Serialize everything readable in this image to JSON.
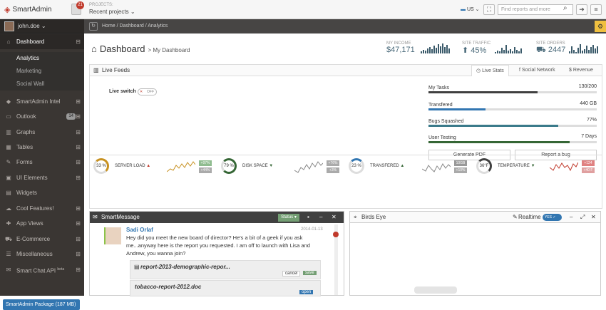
{
  "app": {
    "name": "SmartAdmin",
    "notif_count": "21",
    "projects_label": "PROJECTS:",
    "projects_value": "Recent projects",
    "lang": "US",
    "search_placeholder": "Find reports and more"
  },
  "user": {
    "name": "john.doe"
  },
  "sidebar": {
    "items": [
      {
        "label": "Dashboard",
        "icon": "home-icon",
        "active": true
      },
      {
        "label": "SmartAdmin Intel",
        "icon": "cube-icon"
      },
      {
        "label": "Outlook",
        "icon": "inbox-icon",
        "badge": "14"
      },
      {
        "label": "Graphs",
        "icon": "bar-chart-icon"
      },
      {
        "label": "Tables",
        "icon": "table-icon"
      },
      {
        "label": "Forms",
        "icon": "pencil-icon"
      },
      {
        "label": "UI Elements",
        "icon": "desktop-icon"
      },
      {
        "label": "Widgets",
        "icon": "widget-icon"
      },
      {
        "label": "Cool Features!",
        "icon": "cloud-icon"
      },
      {
        "label": "App Views",
        "icon": "puzzle-icon"
      },
      {
        "label": "E-Commerce",
        "icon": "cart-icon"
      },
      {
        "label": "Miscellaneous",
        "icon": "list-icon"
      },
      {
        "label": "Smart Chat API",
        "sup": "beta",
        "icon": "chat-icon"
      }
    ],
    "subitems": [
      "Analytics",
      "Marketing",
      "Social Wall"
    ],
    "package": "SmartAdmin Package (187 MB)"
  },
  "breadcrumb": [
    "Home",
    "Dashboard",
    "Analytics"
  ],
  "page": {
    "title": "Dashboard",
    "subtitle": "> My Dashboard"
  },
  "stats": [
    {
      "label": "MY INCOME",
      "value": "$47,171"
    },
    {
      "label": "SITE TRAFFIC",
      "value": "45%"
    },
    {
      "label": "SITE ORDERS",
      "value": "2447"
    }
  ],
  "live": {
    "title": "Live Feeds",
    "tabs": [
      "Live Stats",
      "Social Network",
      "Revenue"
    ],
    "switch_label": "Live switch",
    "switch_state": "OFF",
    "tasks": [
      {
        "label": "My Tasks",
        "value": "130/200",
        "pct": 0.65,
        "color": "#404040"
      },
      {
        "label": "Transfered",
        "value": "440 GB",
        "pct": 0.34,
        "color": "#3276b1"
      },
      {
        "label": "Bugs Squashed",
        "value": "77%",
        "pct": 0.77,
        "color": "#3a7a8a"
      },
      {
        "label": "User Testing",
        "value": "7 Days",
        "pct": 0.84,
        "color": "#356635"
      }
    ],
    "buttons": [
      "Generate PDF",
      "Report a bug"
    ],
    "gauges": [
      {
        "value": "33 %",
        "name": "SERVER LOAD",
        "arrow": "▲",
        "tag1": "+97%",
        "tag2": "+44%",
        "c": "#c79121"
      },
      {
        "value": "79 %",
        "name": "DISK SPACE",
        "arrow": "▼",
        "tag1": "+76%",
        "tag2": "+3%",
        "c": "#356635"
      },
      {
        "value": "23 %",
        "name": "TRANSFERED",
        "arrow": "▲",
        "tag1": "10GB",
        "tag2": "+10%",
        "c": "#3276b1"
      },
      {
        "value": "36°F",
        "name": "TEMPERATURE",
        "arrow": "▼",
        "tag1": "+124",
        "tag2": "+40 F",
        "c": "#404040"
      }
    ]
  },
  "smartmessage": {
    "title": "SmartMessage",
    "status": "Status",
    "author": "Sadi Orlaf",
    "date": "2014-01-13",
    "text": "Hey did you meet the new board of director? He's a bit of a geek if you ask me...anyway here is the report you requested. I am off to launch with Lisa and Andrew, you wanna join?",
    "file1": "report-2013-demographic-repor...",
    "file2": "tobacco-report-2012.doc",
    "cancel": "cancel",
    "save": "save",
    "open": "open"
  },
  "birdseye": {
    "title": "Birds Eye",
    "realtime": "Realtime",
    "toggle": "YES"
  }
}
